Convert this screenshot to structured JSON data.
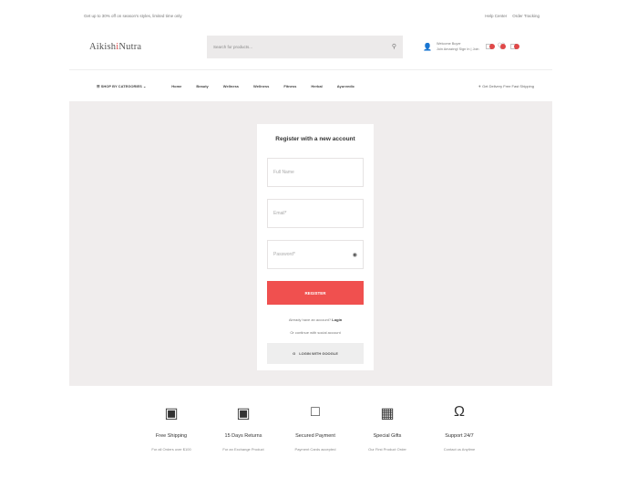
{
  "topbar": {
    "promo": "Get up to 30% off on season's styles, limited time only",
    "links": [
      "Help Center",
      "Order Tracking"
    ]
  },
  "header": {
    "logo_main": "Aikish",
    "logo_accent": "i",
    "logo_end": "Nutra",
    "search_placeholder": "Search for products...",
    "account_line1": "Welcome Buyer",
    "account_line2": "Join Amazing! Sign In | Join",
    "icons": [
      "compare-icon",
      "wishlist-icon",
      "cart-icon"
    ]
  },
  "nav": {
    "categories_label": "SHOP BY CATEGORIES",
    "links": [
      "Home",
      "Beauty",
      "Wellness",
      "Wellness",
      "Fitness",
      "Herbal",
      "Ayurvedic"
    ],
    "shipping_note": "Get Delivery Free Fast Shipping"
  },
  "register": {
    "title": "Register with a new account",
    "full_name_placeholder": "Full Name",
    "email_placeholder": "Email*",
    "password_placeholder": "Password*",
    "register_button": "REGISTER",
    "login_prompt": "Already have an account?",
    "login_link": "Login",
    "social_prompt": "Or continue with social account",
    "google_button": "LOGIN WITH GOOGLE"
  },
  "features": [
    {
      "icon": "truck-icon",
      "title": "Free Shipping",
      "sub": "For all Orders over $100"
    },
    {
      "icon": "calendar-icon",
      "title": "15 Days Returns",
      "sub": "For an Exchange Product"
    },
    {
      "icon": "card-icon",
      "title": "Secured Payment",
      "sub": "Payment Cards accepted"
    },
    {
      "icon": "gift-icon",
      "title": "Special Gifts",
      "sub": "Our First Product Order"
    },
    {
      "icon": "headset-icon",
      "title": "Support 24/7",
      "sub": "Contact us Anytime"
    }
  ]
}
